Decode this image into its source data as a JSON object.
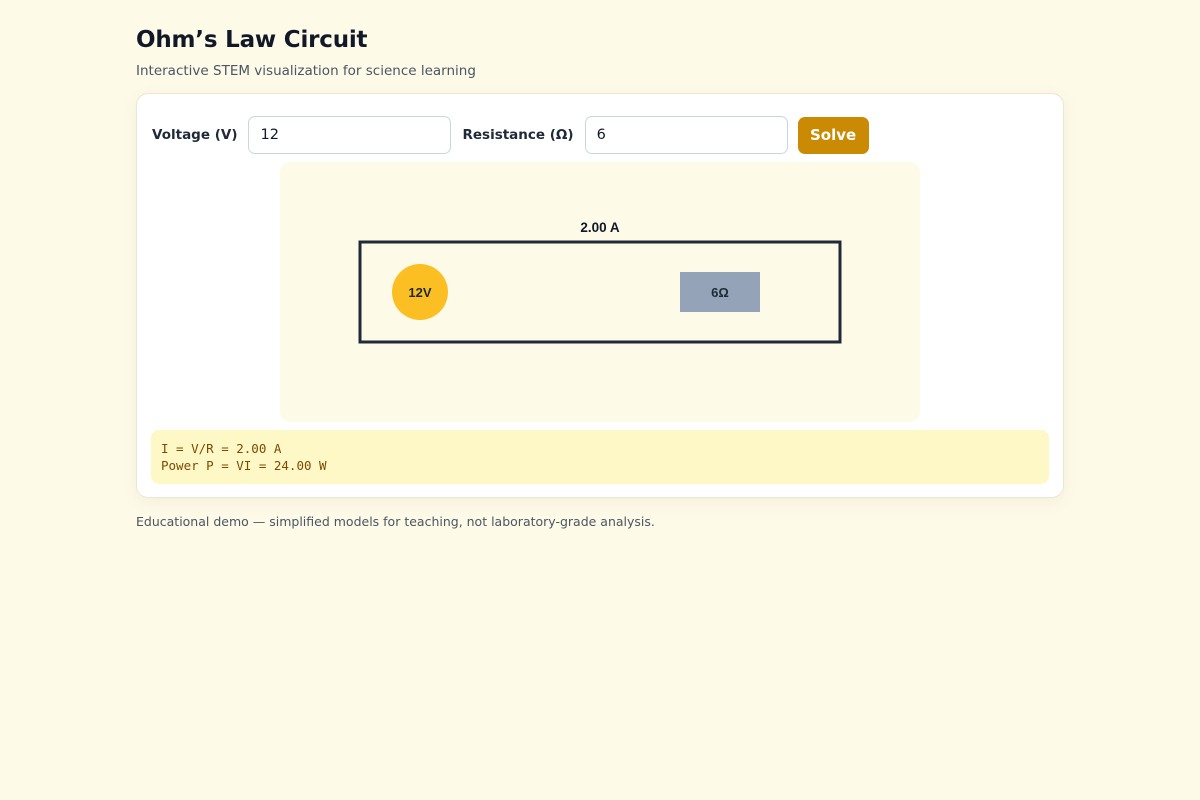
{
  "header": {
    "title": "Ohm’s Law Circuit",
    "subtitle": "Interactive STEM visualization for science learning"
  },
  "controls": {
    "voltage_label": "Voltage (V)",
    "voltage_value": "12",
    "resistance_label": "Resistance (Ω)",
    "resistance_value": "6",
    "solve_label": "Solve"
  },
  "circuit": {
    "current_label": "2.00 A",
    "battery_label": "12V",
    "resistor_label": "6Ω",
    "colors": {
      "wire": "#1f2937",
      "battery": "#fbbf24",
      "resistor": "#94a3b8"
    }
  },
  "results": {
    "current_line": "I = V/R = 2.00 A",
    "power_line": "Power P = VI = 24.00 W"
  },
  "footer": {
    "note": "Educational demo — simplified models for teaching, not laboratory-grade analysis."
  },
  "colors": {
    "accent": "#ca8a04",
    "background": "#fefae8",
    "result_bg": "#fef8c6"
  }
}
